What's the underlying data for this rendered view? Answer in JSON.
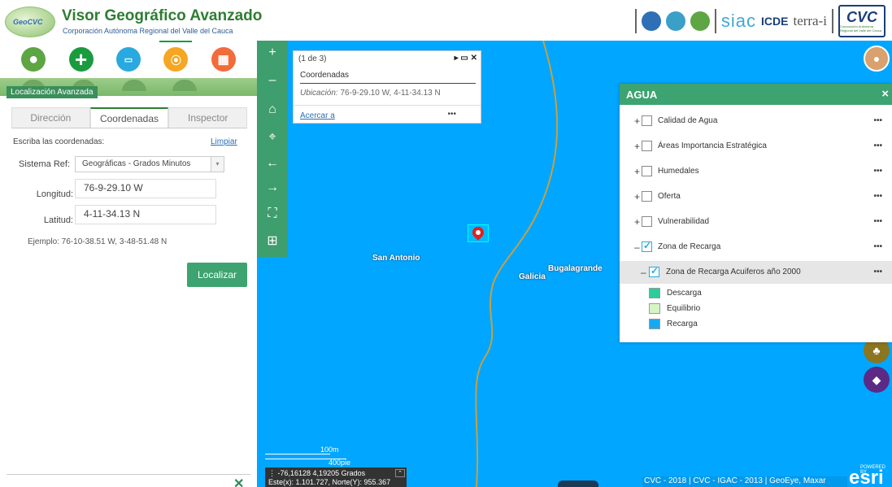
{
  "header": {
    "logo_text": "GeoCVC",
    "title": "Visor Geográfico Avanzado",
    "subtitle": "Corporación Autónoma Regional del Valle del Cauca",
    "partners": {
      "siac": "siac",
      "icde": "ICDE",
      "terrai": "terra-i",
      "cvc": "CVC",
      "cvc_sub": "Corporación Autónoma Regional del Valle del Cauca"
    }
  },
  "toolbar": {
    "items": [
      {
        "name": "pin-tool",
        "icon": "pin-icon"
      },
      {
        "name": "add-tool",
        "icon": "plus-icon"
      },
      {
        "name": "measure-tool",
        "icon": "ruler-icon"
      },
      {
        "name": "locate-tool",
        "icon": "location-icon"
      },
      {
        "name": "calc-tool",
        "icon": "calculator-icon"
      }
    ],
    "plus_glyph": "+",
    "ruler_glyph": "▭",
    "loc_glyph": "⦿",
    "calc_glyph": "▦",
    "pin_glyph": "●"
  },
  "panel": {
    "label": "Localización Avanzada",
    "tabs": [
      "Dirección",
      "Coordenadas",
      "Inspector"
    ],
    "active_tab": "Coordenadas",
    "hint": "Escriba las coordenadas:",
    "clear_link": "Limpiar",
    "sistema_label": "Sistema Ref:",
    "sistema_value": "Geográficas - Grados Minutos",
    "longitud_label": "Longitud:",
    "longitud_value": "76-9-29.10 W",
    "latitud_label": "Latitud:",
    "latitud_value": "4-11-34.13 N",
    "ejemplo": "Ejemplo:  76-10-38.51 W, 3-48-51.48 N",
    "localizar_button": "Localizar",
    "close_glyph": "✕"
  },
  "map": {
    "nav": {
      "zoom_in": "+",
      "zoom_out": "–",
      "home": "⌂",
      "locate": "⌖",
      "back": "←",
      "forward": "→",
      "fullscreen": "⛶",
      "extent": "⊞"
    },
    "popup": {
      "count": "(1 de 3)",
      "controls": "▸ ▭ ✕",
      "title": "Coordenadas",
      "body_label": "Ubicación:",
      "body_value": "76-9-29.10 W, 4-11-34.13 N",
      "link": "Acercar a",
      "more": "•••"
    },
    "places": {
      "san_antonio": "San Antonio",
      "galicia": "Galicia",
      "bugalagrande": "Bugalagrande"
    },
    "scale": {
      "m": "100m",
      "ft": "400pie"
    },
    "coords": {
      "line1": "-76,16128 4,19205 Grados",
      "line2": "Este(x): 1.101.727, Norte(Y): 955.367",
      "toggle": "⌃",
      "menu": "⋮"
    },
    "attribution": "CVC - 2018 | CVC - IGAC - 2013 | GeoEye, Maxar",
    "esri": {
      "powered": "POWERED BY",
      "brand": "esri"
    },
    "colors": {
      "water": "#00a6ff",
      "river_line": "#c8a040"
    }
  },
  "layers": {
    "title": "AGUA",
    "close_glyph": "×",
    "items": [
      {
        "name": "Calidad de Agua",
        "expand": "+",
        "checked": false
      },
      {
        "name": "Áreas Importancia Estratégica",
        "expand": "+",
        "checked": false
      },
      {
        "name": "Humedales",
        "expand": "+",
        "checked": false
      },
      {
        "name": "Oferta",
        "expand": "+",
        "checked": false
      },
      {
        "name": "Vulnerabilidad",
        "expand": "+",
        "checked": false
      },
      {
        "name": "Zona de Recarga",
        "expand": "–",
        "checked": true
      }
    ],
    "sublayer": {
      "name": "Zona de Recarga Acuiferos año 2000",
      "expand": "–",
      "checked": true
    },
    "legend": [
      {
        "label": "Descarga",
        "color": "#2ecc9a"
      },
      {
        "label": "Equilibrio",
        "color": "#d6f5c4"
      },
      {
        "label": "Recarga",
        "color": "#16a9f0"
      }
    ],
    "more": "•••"
  }
}
